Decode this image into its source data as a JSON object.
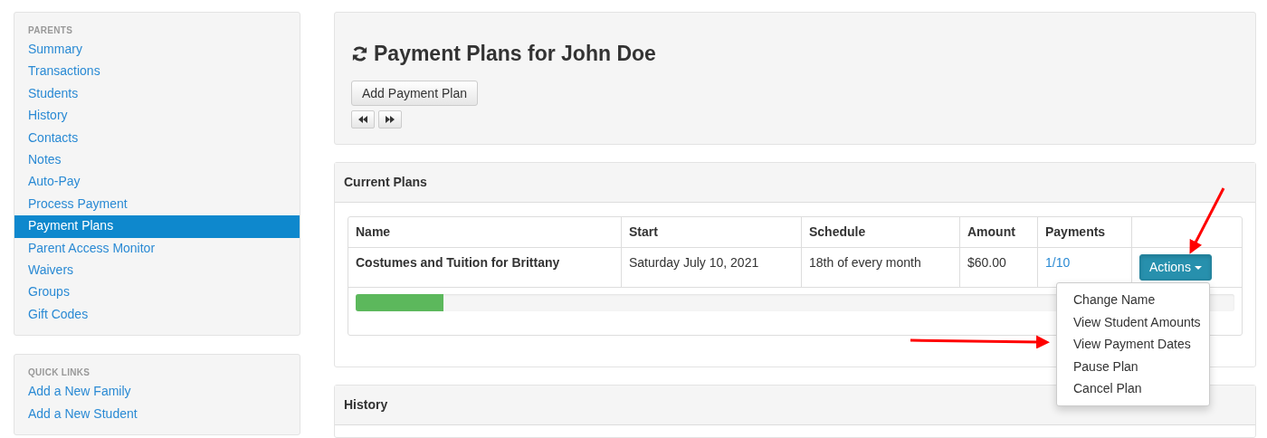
{
  "sidebar": [
    {
      "heading": "PARENTS",
      "items": [
        {
          "label": "Summary",
          "selected": false
        },
        {
          "label": "Transactions",
          "selected": false
        },
        {
          "label": "Students",
          "selected": false
        },
        {
          "label": "History",
          "selected": false
        },
        {
          "label": "Contacts",
          "selected": false
        },
        {
          "label": "Notes",
          "selected": false
        },
        {
          "label": "Auto-Pay",
          "selected": false
        },
        {
          "label": "Process Payment",
          "selected": false
        },
        {
          "label": "Payment Plans",
          "selected": true
        },
        {
          "label": "Parent Access Monitor",
          "selected": false
        },
        {
          "label": "Waivers",
          "selected": false
        },
        {
          "label": "Groups",
          "selected": false
        },
        {
          "label": "Gift Codes",
          "selected": false
        }
      ]
    },
    {
      "heading": "QUICK LINKS",
      "items": [
        {
          "label": "Add a New Family",
          "selected": false
        },
        {
          "label": "Add a New Student",
          "selected": false
        }
      ]
    }
  ],
  "page": {
    "title": "Payment Plans for John Doe",
    "add_button": "Add Payment Plan"
  },
  "current_plans": {
    "title": "Current Plans",
    "columns": [
      "Name",
      "Start",
      "Schedule",
      "Amount",
      "Payments"
    ],
    "rows": [
      {
        "name": "Costumes and Tuition for Brittany",
        "start": "Saturday July 10, 2021",
        "schedule": "18th of every month",
        "amount": "$60.00",
        "payments": "1/10",
        "level": 0.1,
        "action": "Actions",
        "menu_open": true,
        "menu": [
          "Change Name",
          "View Student Amounts",
          "View Payment Dates",
          "Pause Plan",
          "Cancel Plan"
        ]
      }
    ]
  },
  "history": {
    "title": "History"
  }
}
